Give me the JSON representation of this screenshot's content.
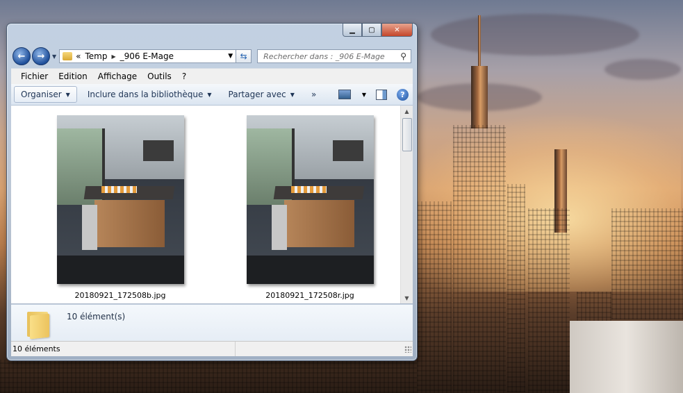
{
  "window": {
    "address": {
      "overflow": "«",
      "crumbs": [
        "Temp",
        "_906 E-Mage"
      ]
    },
    "search_placeholder": "Rechercher dans : _906 E-Mage",
    "menu": [
      "Fichier",
      "Edition",
      "Affichage",
      "Outils",
      "?"
    ],
    "commands": {
      "organize": "Organiser",
      "include_library": "Inclure dans la bibliothèque",
      "share_with": "Partager avec",
      "more": "»"
    },
    "files": [
      {
        "name": "20180921_172508b.jpg"
      },
      {
        "name": "20180921_172508r.jpg"
      }
    ],
    "details_text": "10 élément(s)",
    "status_text": "10 éléments"
  },
  "icons": {
    "back": "back-arrow-icon",
    "forward": "forward-arrow-icon",
    "refresh": "refresh-icon",
    "search": "search-icon",
    "views": "views-icon",
    "preview_pane": "preview-pane-icon",
    "help": "help-icon"
  },
  "colors": {
    "accent": "#1f4f9a",
    "toolbar_text": "#1e3455"
  }
}
